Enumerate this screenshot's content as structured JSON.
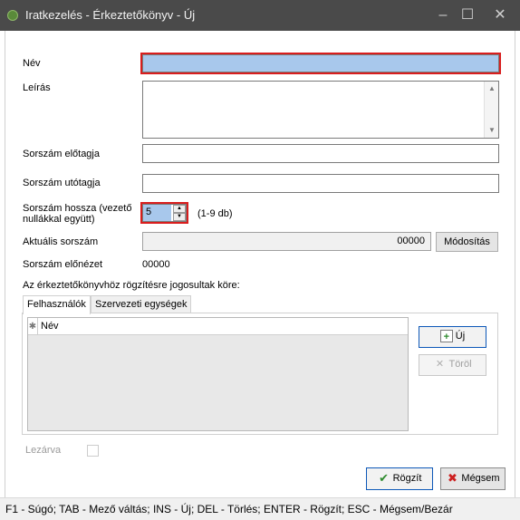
{
  "window": {
    "title": "Iratkezelés - Érkeztetőkönyv - Új",
    "controls": [
      "–",
      "☐",
      "✕"
    ]
  },
  "form": {
    "name_label": "Név",
    "name_value": "",
    "description_label": "Leírás",
    "description_value": "",
    "prefix_label": "Sorszám előtagja",
    "prefix_value": "",
    "suffix_label": "Sorszám utótagja",
    "suffix_value": "",
    "length_label": "Sorszám hossza (vezető nullákkal együtt)",
    "length_value": "5",
    "length_hint": "(1-9 db)",
    "current_label": "Aktuális sorszám",
    "current_value": "00000",
    "modify_button": "Módosítás",
    "preview_label": "Sorszám előnézet",
    "preview_value": "00000",
    "permissions_label": "Az érkeztetőkönyvhöz rögzítésre jogosultak köre:",
    "closed_label": "Lezárva"
  },
  "tabs": [
    {
      "label": "Felhasználók",
      "active": true
    },
    {
      "label": "Szervezeti egységek",
      "active": false
    }
  ],
  "grid": {
    "columns": [
      "Név"
    ],
    "rows": []
  },
  "grid_buttons": {
    "new": "Új",
    "delete": "Töröl"
  },
  "buttons": {
    "save": "Rögzít",
    "cancel": "Mégsem"
  },
  "statusbar": {
    "text": "F1 - Súgó; TAB - Mező váltás; INS - Új; DEL - Törlés; ENTER - Rögzít; ESC - Mégsem/Bezár"
  },
  "colors": {
    "titlebar": "#4a4a4a",
    "focus_highlight": "#d91e1e",
    "selection": "#a8c8ec",
    "ok_check": "#2e8b2e",
    "cancel_x": "#cc1f1f"
  }
}
